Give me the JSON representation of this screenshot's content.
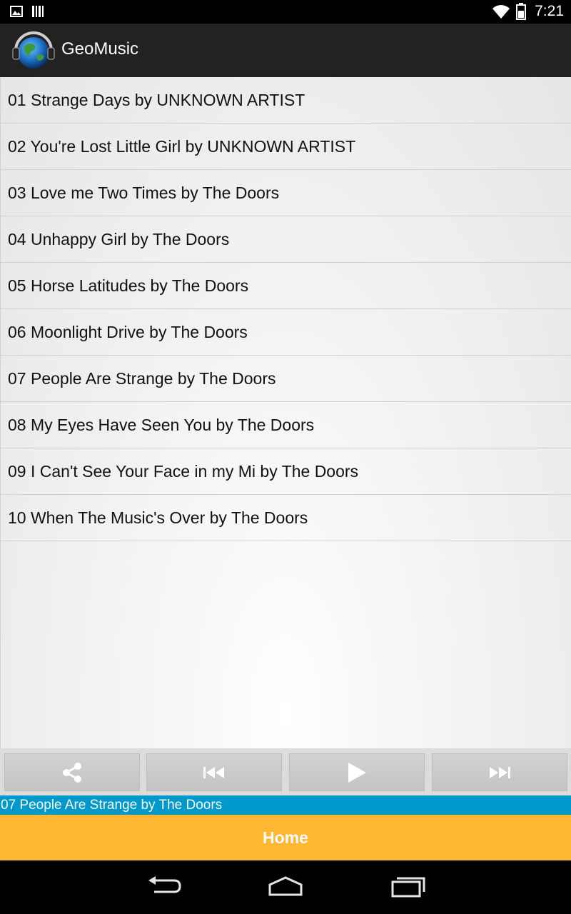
{
  "status_bar": {
    "left_icons": [
      "gallery-icon",
      "barcode-icon"
    ],
    "right_icons": [
      "wifi-icon",
      "battery-icon"
    ],
    "time": "7:21"
  },
  "action_bar": {
    "app_title": "GeoMusic",
    "logo_icon": "globe-headphones-icon"
  },
  "tracks": [
    {
      "label": "01 Strange Days by UNKNOWN ARTIST"
    },
    {
      "label": "02 You're Lost Little Girl by UNKNOWN ARTIST"
    },
    {
      "label": "03 Love me Two Times by The Doors"
    },
    {
      "label": "04 Unhappy Girl by The Doors"
    },
    {
      "label": "05 Horse Latitudes by The Doors"
    },
    {
      "label": "06 Moonlight Drive by The Doors"
    },
    {
      "label": "07 People Are Strange by The Doors"
    },
    {
      "label": "08 My Eyes Have Seen You by The Doors"
    },
    {
      "label": "09 I Can't See Your Face in my Mi by The Doors"
    },
    {
      "label": "10 When The Music's Over by The Doors"
    }
  ],
  "controls": {
    "buttons": [
      "share-icon",
      "previous-icon",
      "play-icon",
      "next-icon"
    ]
  },
  "now_playing": "07 People Are Strange by The Doors",
  "home_label": "Home",
  "nav_bar": {
    "buttons": [
      "back-icon",
      "home-icon",
      "recent-apps-icon"
    ]
  },
  "colors": {
    "now_playing_bg": "#0099cc",
    "home_bg": "#ffb732",
    "action_bar_bg": "#222222"
  }
}
